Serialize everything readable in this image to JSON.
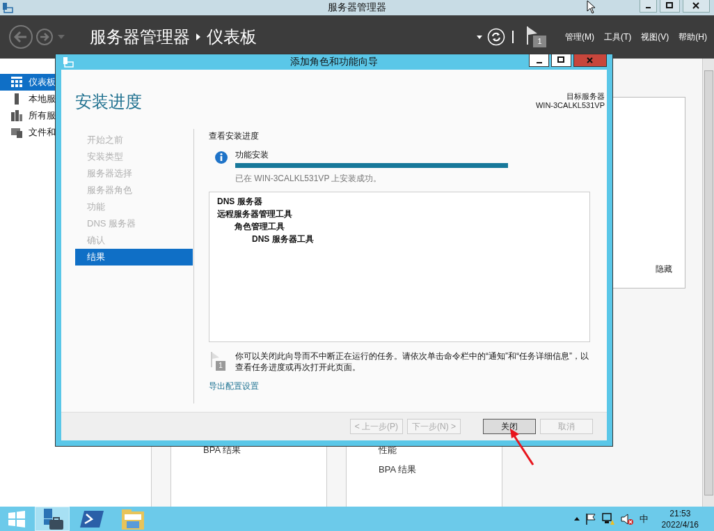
{
  "window": {
    "title": "服务器管理器"
  },
  "header": {
    "breadcrumb": [
      "服务器管理器",
      "仪表板"
    ],
    "flag_count": "1",
    "menus": [
      "管理(M)",
      "工具(T)",
      "视图(V)",
      "帮助(H)"
    ]
  },
  "sidebar": {
    "items": [
      {
        "label": "仪表板",
        "kind": "dashboard",
        "selected": true
      },
      {
        "label": "本地服",
        "kind": "server",
        "selected": false
      },
      {
        "label": "所有服",
        "kind": "servers",
        "selected": false
      },
      {
        "label": "文件和",
        "kind": "files",
        "selected": false
      }
    ]
  },
  "dashboard": {
    "hide_label": "隐藏",
    "tiles": [
      {
        "lines": [
          "BPA 结果"
        ]
      },
      {
        "lines": [
          "性能",
          "BPA 结果"
        ]
      }
    ]
  },
  "dialog": {
    "title": "添加角色和功能向导",
    "heading": "安装进度",
    "target_label": "目标服务器",
    "target_server": "WIN-3CALKL531VP",
    "steps": [
      {
        "label": "开始之前",
        "selected": false
      },
      {
        "label": "安装类型",
        "selected": false
      },
      {
        "label": "服务器选择",
        "selected": false
      },
      {
        "label": "服务器角色",
        "selected": false
      },
      {
        "label": "功能",
        "selected": false
      },
      {
        "label": "DNS 服务器",
        "selected": false
      },
      {
        "label": "确认",
        "selected": false
      },
      {
        "label": "结果",
        "selected": true
      }
    ],
    "section_title": "查看安装进度",
    "progress": {
      "label": "功能安装",
      "level": 1,
      "status": "已在 WIN-3CALKL531VP 上安装成功。"
    },
    "results": [
      {
        "label": "DNS 服务器"
      },
      {
        "label": "远程服务器管理工具",
        "children": [
          {
            "label": "角色管理工具",
            "children": [
              {
                "label": "DNS 服务器工具"
              }
            ]
          }
        ]
      }
    ],
    "note": {
      "badge": "1",
      "text": "你可以关闭此向导而不中断正在运行的任务。请依次单击命令栏中的“通知”和“任务详细信息”，以查看任务进度或再次打开此页面。"
    },
    "export_link": "导出配置设置",
    "buttons": [
      {
        "label": "< 上一步(P)",
        "disabled": true,
        "default": false
      },
      {
        "label": "下一步(N) >",
        "disabled": true,
        "default": false
      },
      {
        "label": "关闭",
        "disabled": false,
        "default": true
      },
      {
        "label": "取消",
        "disabled": true,
        "default": false
      }
    ]
  },
  "taskbar": {
    "apps": [
      {
        "kind": "server-manager",
        "selected": true
      },
      {
        "kind": "powershell",
        "selected": false
      },
      {
        "kind": "explorer",
        "selected": false
      }
    ],
    "ime": "中",
    "time": "21:53",
    "date": "2022/4/16"
  }
}
